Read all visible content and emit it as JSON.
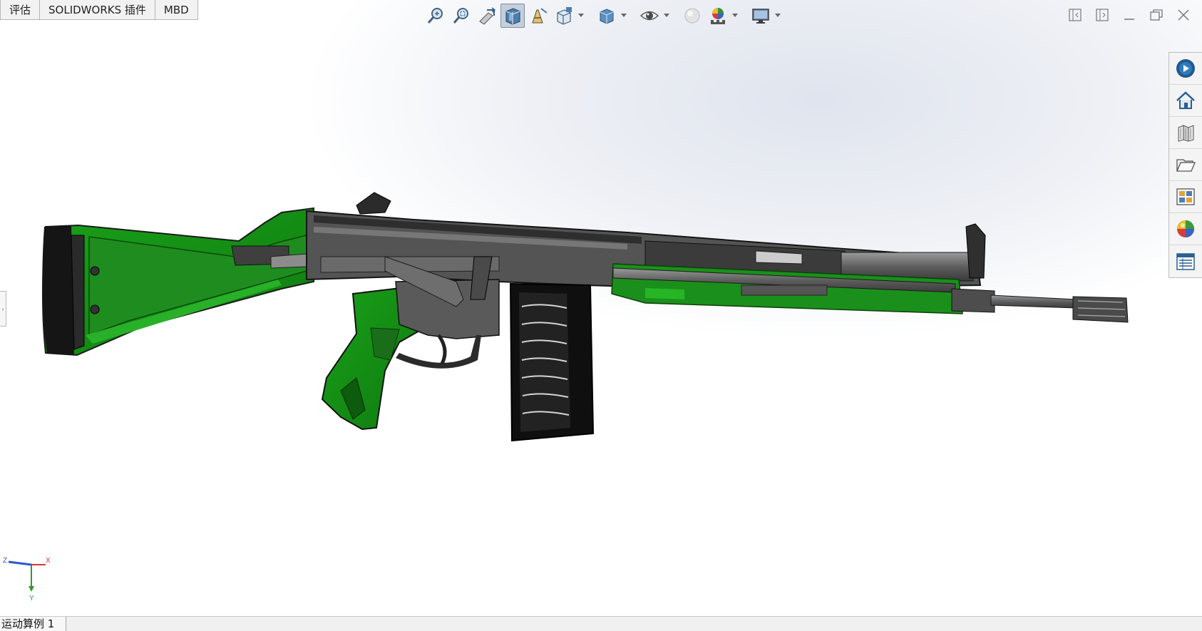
{
  "tabs": [
    {
      "label": "评估"
    },
    {
      "label": "SOLIDWORKS 插件"
    },
    {
      "label": "MBD"
    }
  ],
  "hud_toolbar": [
    {
      "icon": "zoom-to-fit-icon"
    },
    {
      "icon": "zoom-to-area-icon"
    },
    {
      "icon": "previous-view-icon"
    },
    {
      "icon": "section-view-icon",
      "active": true
    },
    {
      "icon": "dynamic-annotation-views-icon"
    },
    {
      "icon": "view-orientation-icon",
      "dropdown": true
    },
    {
      "icon": "display-style-icon",
      "dropdown": true
    },
    {
      "icon": "hide-show-items-icon",
      "dropdown": true
    },
    {
      "icon": "edit-appearance-icon"
    },
    {
      "icon": "apply-scene-icon",
      "dropdown": true
    },
    {
      "icon": "view-settings-icon",
      "dropdown": true
    }
  ],
  "window_controls": [
    "restore-left-icon",
    "restore-right-icon",
    "minimize-icon",
    "maximize-icon",
    "close-icon"
  ],
  "task_pane": [
    "solidworks-resources-icon",
    "home-icon",
    "design-library-icon",
    "file-explorer-icon",
    "view-palette-icon",
    "appearances-scenes-icon",
    "custom-properties-icon"
  ],
  "model": {
    "description_colors": {
      "stock": "#129012",
      "metal": "#4a4a4a",
      "dark": "#1c1c1c",
      "barrel": "#6a6a6a"
    }
  },
  "triad": {
    "x_label": "X",
    "y_label": "Y",
    "z_label": "Z"
  },
  "status": {
    "motion_tab": "运动算例 1"
  },
  "colors": {
    "accent_green": "#129012",
    "toolbar_active": "#c4cfdc"
  }
}
